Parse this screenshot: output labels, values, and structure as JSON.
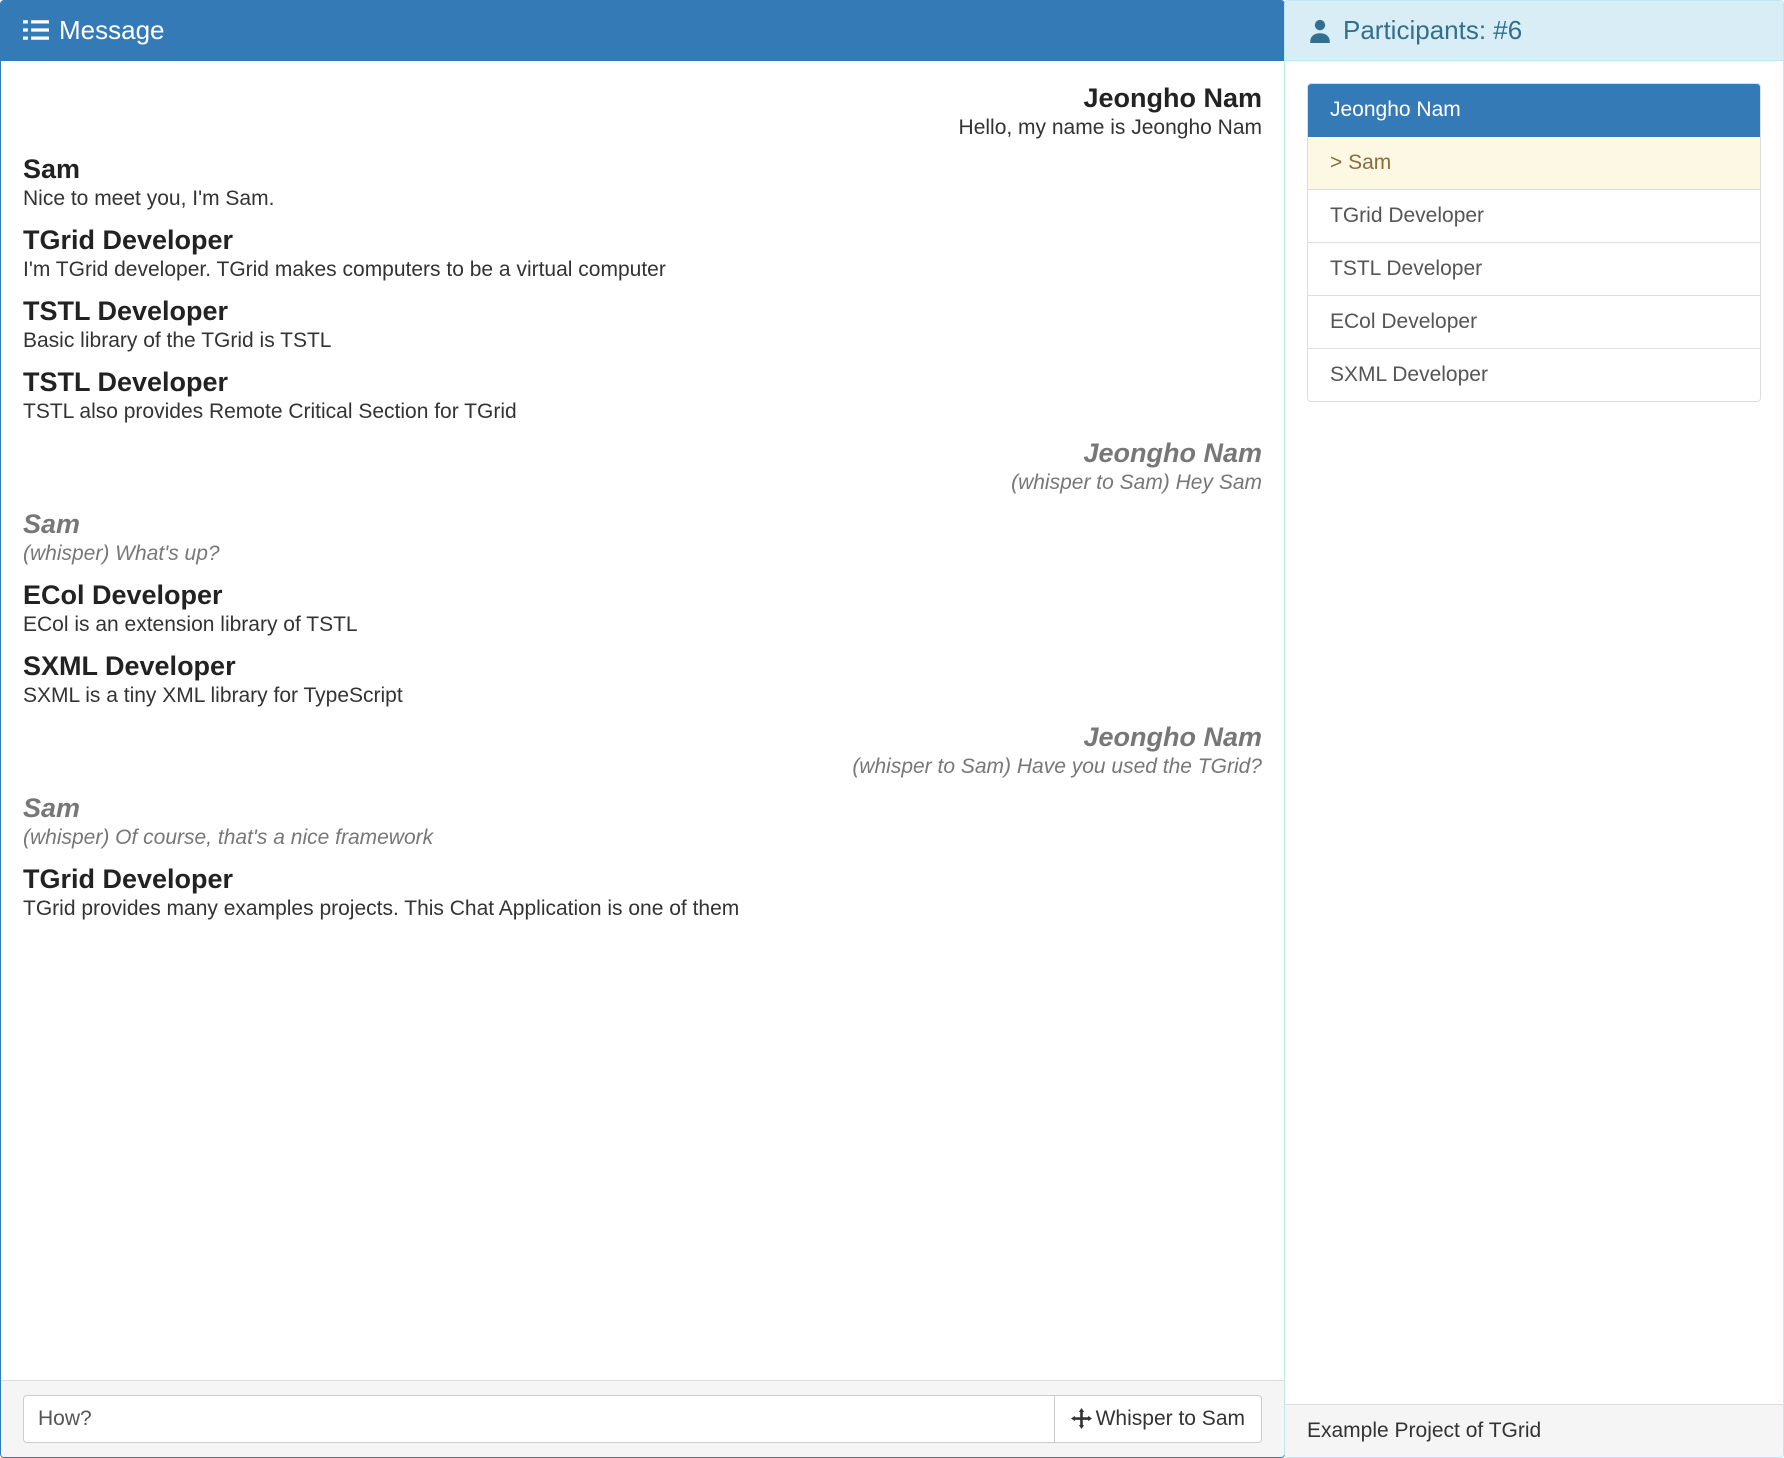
{
  "message_panel": {
    "title": "Message",
    "messages": [
      {
        "author": "Jeongho Nam",
        "text": "Hello, my name is Jeongho Nam",
        "self": true,
        "whisper": false
      },
      {
        "author": "Sam",
        "text": "Nice to meet you, I'm Sam.",
        "self": false,
        "whisper": false
      },
      {
        "author": "TGrid Developer",
        "text": "I'm TGrid developer. TGrid makes computers to be a virtual computer",
        "self": false,
        "whisper": false
      },
      {
        "author": "TSTL Developer",
        "text": "Basic library of the TGrid is TSTL",
        "self": false,
        "whisper": false
      },
      {
        "author": "TSTL Developer",
        "text": "TSTL also provides Remote Critical Section for TGrid",
        "self": false,
        "whisper": false
      },
      {
        "author": "Jeongho Nam",
        "text": "(whisper to Sam) Hey Sam",
        "self": true,
        "whisper": true
      },
      {
        "author": "Sam",
        "text": "(whisper) What's up?",
        "self": false,
        "whisper": true
      },
      {
        "author": "ECol Developer",
        "text": "ECol is an extension library of TSTL",
        "self": false,
        "whisper": false
      },
      {
        "author": "SXML Developer",
        "text": "SXML is a tiny XML library for TypeScript",
        "self": false,
        "whisper": false
      },
      {
        "author": "Jeongho Nam",
        "text": "(whisper to Sam) Have you used the TGrid?",
        "self": true,
        "whisper": true
      },
      {
        "author": "Sam",
        "text": "(whisper) Of course, that's a nice framework",
        "self": false,
        "whisper": true
      },
      {
        "author": "TGrid Developer",
        "text": "TGrid provides many examples projects. This Chat Application is one of them",
        "self": false,
        "whisper": false
      }
    ],
    "input_value": "How?",
    "whisper_button_label": "Whisper to Sam"
  },
  "participants_panel": {
    "title": "Participants: #6",
    "items": [
      {
        "name": "Jeongho Nam",
        "state": "active"
      },
      {
        "name": "Sam",
        "state": "warning"
      },
      {
        "name": "TGrid Developer",
        "state": ""
      },
      {
        "name": "TSTL Developer",
        "state": ""
      },
      {
        "name": "ECol Developer",
        "state": ""
      },
      {
        "name": "SXML Developer",
        "state": ""
      }
    ],
    "footer": "Example Project of TGrid"
  }
}
